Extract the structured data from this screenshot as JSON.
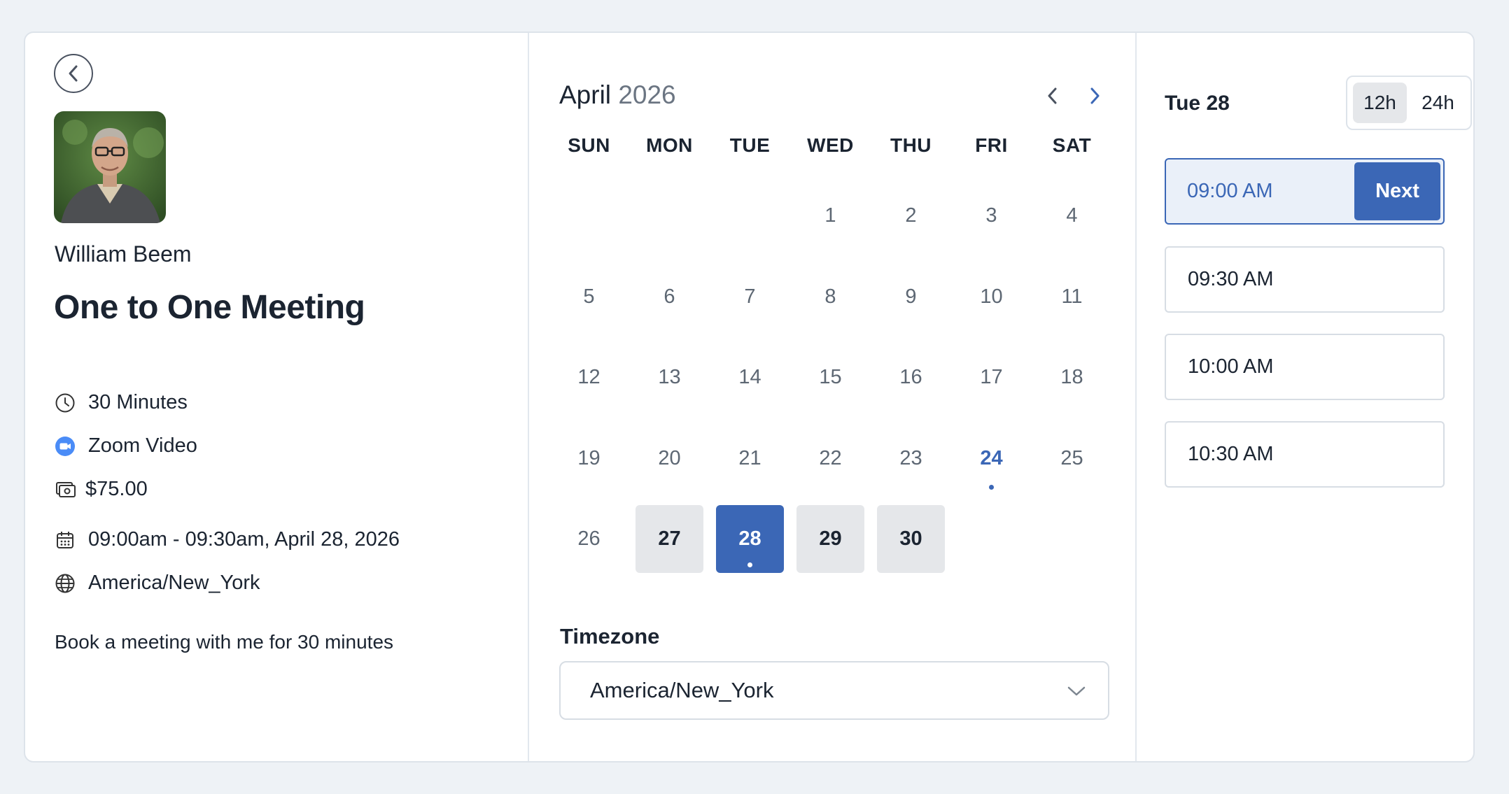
{
  "host": {
    "name": "William Beem",
    "avatar_alt": "William Beem"
  },
  "event": {
    "title": "One to One Meeting",
    "duration": "30 Minutes",
    "location": "Zoom Video",
    "price": "$75.00",
    "datetime": "09:00am - 09:30am, April 28, 2026",
    "timezone": "America/New_York",
    "description": "Book a meeting with me for 30 minutes"
  },
  "calendar": {
    "month": "April",
    "year": "2026",
    "weekdays": [
      "SUN",
      "MON",
      "TUE",
      "WED",
      "THU",
      "FRI",
      "SAT"
    ],
    "first_weekday_index": 3,
    "days_in_month": 30,
    "today": 24,
    "selected": 28,
    "available": [
      27,
      28,
      29,
      30
    ]
  },
  "timezone_field": {
    "label": "Timezone",
    "value": "America/New_York"
  },
  "slots_panel": {
    "day_label": "Tue 28",
    "format_options": [
      "12h",
      "24h"
    ],
    "active_format": "12h",
    "slots": [
      "09:00 AM",
      "09:30 AM",
      "10:00 AM",
      "10:30 AM"
    ],
    "selected_slot": "09:00 AM",
    "next_label": "Next"
  },
  "colors": {
    "accent": "#3b67b6",
    "background": "#eef2f6",
    "available_day": "#e5e7ea",
    "zoom_blue": "#4a8cf7"
  }
}
